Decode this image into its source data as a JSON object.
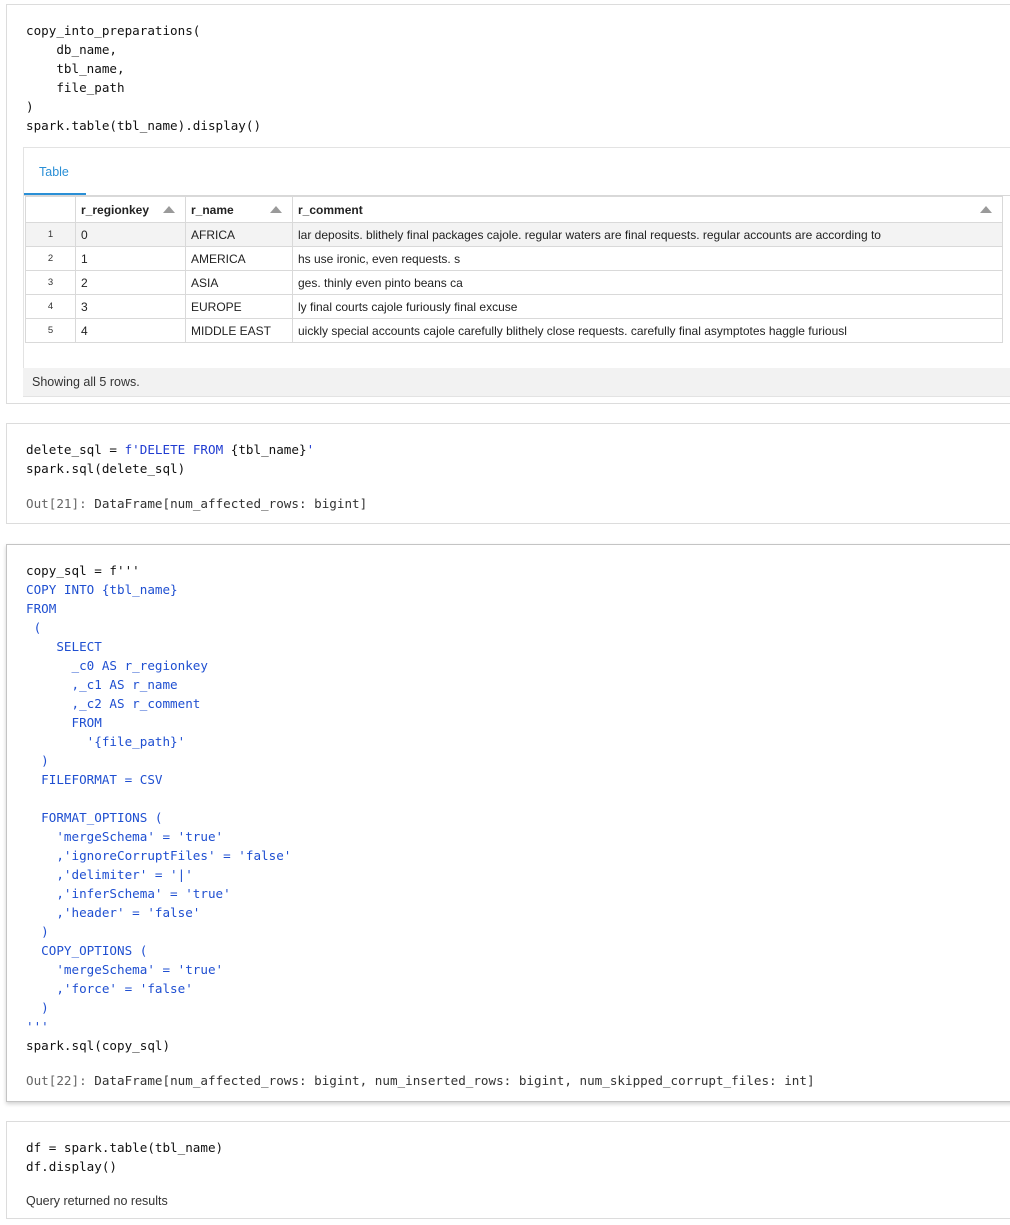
{
  "cell1": {
    "code_lines": [
      "copy_into_preparations(",
      "    db_name,",
      "    tbl_name,",
      "    file_path",
      ")",
      "spark.table(tbl_name).display()"
    ],
    "result": {
      "tab_label": "Table",
      "columns": [
        "",
        "r_regionkey",
        "r_name",
        "r_comment"
      ],
      "rows": [
        {
          "idx": "1",
          "r_regionkey": "0",
          "r_name": "AFRICA",
          "r_comment": "lar deposits. blithely final packages cajole. regular waters are final requests. regular accounts are according to"
        },
        {
          "idx": "2",
          "r_regionkey": "1",
          "r_name": "AMERICA",
          "r_comment": "hs use ironic, even requests. s"
        },
        {
          "idx": "3",
          "r_regionkey": "2",
          "r_name": "ASIA",
          "r_comment": "ges. thinly even pinto beans ca"
        },
        {
          "idx": "4",
          "r_regionkey": "3",
          "r_name": "EUROPE",
          "r_comment": "ly final courts cajole furiously final excuse"
        },
        {
          "idx": "5",
          "r_regionkey": "4",
          "r_name": "MIDDLE EAST",
          "r_comment": "uickly special accounts cajole carefully blithely close requests. carefully final asymptotes haggle furiousl"
        }
      ],
      "status": "Showing all 5 rows."
    }
  },
  "cell2": {
    "line1_a": "delete_sql = ",
    "line1_b": "f'DELETE FROM ",
    "line1_c": "{tbl_name}",
    "line1_d": "'",
    "line2": "spark.sql(delete_sql)",
    "out_prefix": "Out[21]: ",
    "out_text": "DataFrame[num_affected_rows: bigint]"
  },
  "cell3": {
    "code_lines": [
      "copy_sql = f'''",
      "COPY INTO {tbl_name}",
      "FROM",
      " (",
      "    SELECT",
      "      _c0 AS r_regionkey",
      "      ,_c1 AS r_name",
      "      ,_c2 AS r_comment",
      "      FROM",
      "        '{file_path}'",
      "  )",
      "  FILEFORMAT = CSV",
      "",
      "  FORMAT_OPTIONS (",
      "    'mergeSchema' = 'true'",
      "    ,'ignoreCorruptFiles' = 'false'",
      "    ,'delimiter' = '|'",
      "    ,'inferSchema' = 'true'",
      "    ,'header' = 'false'",
      "  )",
      "  COPY_OPTIONS (",
      "    'mergeSchema' = 'true'",
      "    ,'force' = 'false'",
      "  )",
      "'''",
      "spark.sql(copy_sql)"
    ],
    "out_prefix": "Out[22]: ",
    "out_text": "DataFrame[num_affected_rows: bigint, num_inserted_rows: bigint, num_skipped_corrupt_files: int]"
  },
  "cell4": {
    "code_lines": [
      "df = spark.table(tbl_name)",
      "df.display()"
    ],
    "message": "Query returned no results"
  },
  "colors": {
    "keyword": "#1f4fd1",
    "tab_accent": "#2a8fd6",
    "border": "#dcdcdc"
  }
}
